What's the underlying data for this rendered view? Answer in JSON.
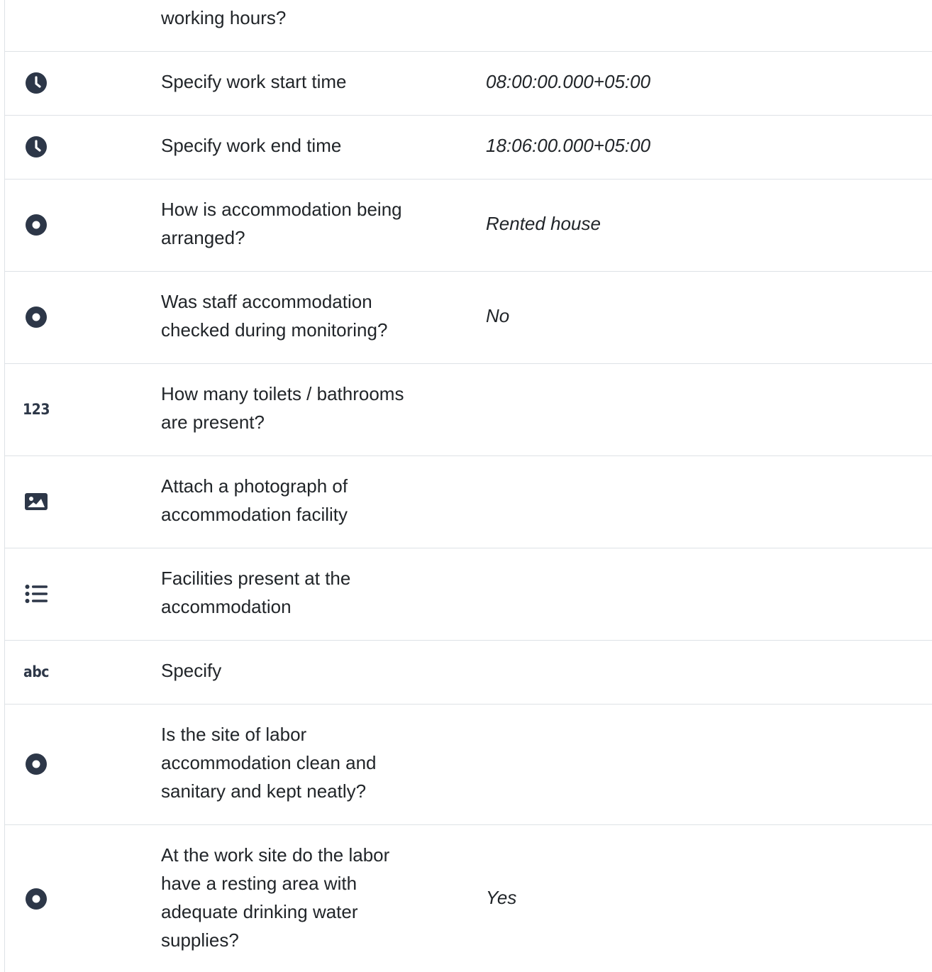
{
  "rows": [
    {
      "icon": "",
      "question": "working hours?",
      "answer": ""
    },
    {
      "icon": "clock-icon",
      "question": "Specify work start time",
      "answer": "08:00:00.000+05:00"
    },
    {
      "icon": "clock-icon",
      "question": "Specify work end time",
      "answer": "18:06:00.000+05:00"
    },
    {
      "icon": "radio-icon",
      "question": "How is accommodation being\narranged?",
      "answer": "Rented house"
    },
    {
      "icon": "radio-icon",
      "question": "Was staff accommodation\nchecked during monitoring?",
      "answer": "No"
    },
    {
      "icon": "number-icon",
      "icon_text": "123",
      "question": "How many toilets / bathrooms\nare present?",
      "answer": ""
    },
    {
      "icon": "image-icon",
      "question": "Attach a photograph of\naccommodation facility",
      "answer": ""
    },
    {
      "icon": "list-icon",
      "question": "Facilities present at the\naccommodation",
      "answer": ""
    },
    {
      "icon": "text-icon",
      "icon_text": "abc",
      "question": "Specify",
      "answer": ""
    },
    {
      "icon": "radio-icon",
      "question": "Is the site of labor\naccommodation clean and\nsanitary and kept neatly?",
      "answer": ""
    },
    {
      "icon": "radio-icon",
      "question": "At the work site do the labor\nhave a resting area with\nadequate drinking water\nsupplies?",
      "answer": "Yes"
    }
  ]
}
